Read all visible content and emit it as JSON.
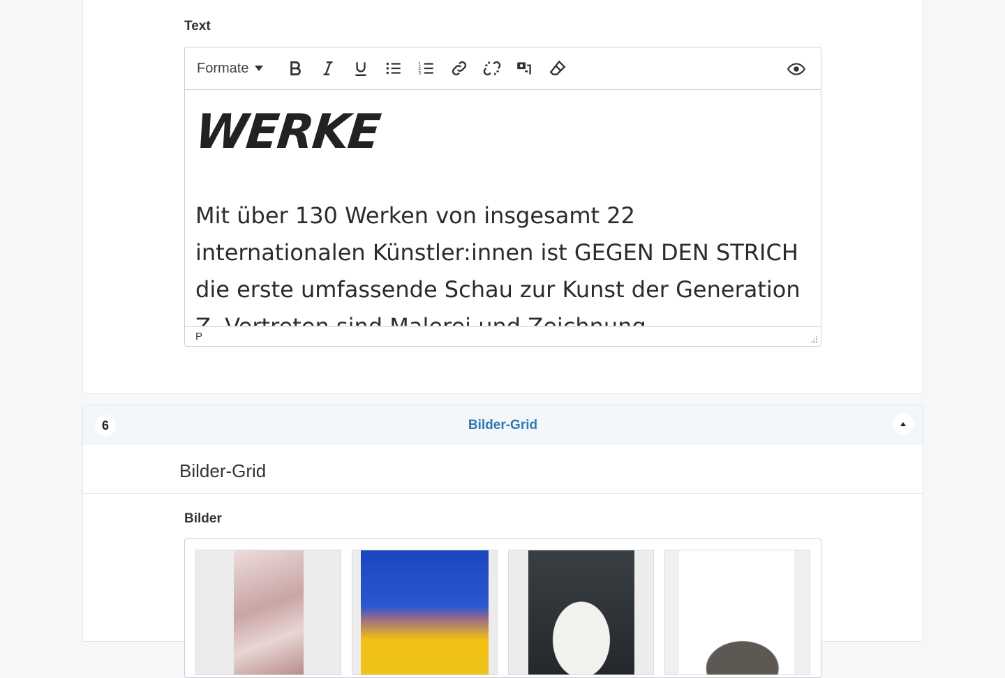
{
  "text_block": {
    "field_label": "Text",
    "toolbar": {
      "format_label": "Formate",
      "buttons": [
        "bold-icon",
        "italic-icon",
        "underline-icon",
        "bullet-list-icon",
        "numbered-list-icon",
        "link-icon",
        "unlink-icon",
        "image-icon",
        "clear-format-icon"
      ],
      "preview_icon": "eye-icon"
    },
    "content": {
      "heading": "WERKE",
      "paragraph": "Mit über 130 Werken von insgesamt 22 internationalen Künstler:innen ist GEGEN DEN STRICH die erste umfassende Schau zur Kunst der Generation Z. Vertreten sind Malerei und Zeichnung"
    },
    "status_path": "P"
  },
  "grid_block": {
    "index": "6",
    "header_title": "Bilder-Grid",
    "block_name": "Bilder-Grid",
    "field_label": "Bilder",
    "images": [
      {
        "name": "thumb-1",
        "colors": [
          "#e9e9e9",
          "#d9b9b6"
        ]
      },
      {
        "name": "thumb-2",
        "colors": [
          "#1f4fc4",
          "#f0c21a"
        ]
      },
      {
        "name": "thumb-3",
        "colors": [
          "#2b2f33",
          "#eeeeea"
        ]
      },
      {
        "name": "thumb-4",
        "colors": [
          "#f1f1f1",
          "#6b6560"
        ]
      }
    ]
  },
  "colors": {
    "accent_link": "#2b79b0",
    "header_bg": "#f4f7fa",
    "border": "#c9ced3"
  }
}
